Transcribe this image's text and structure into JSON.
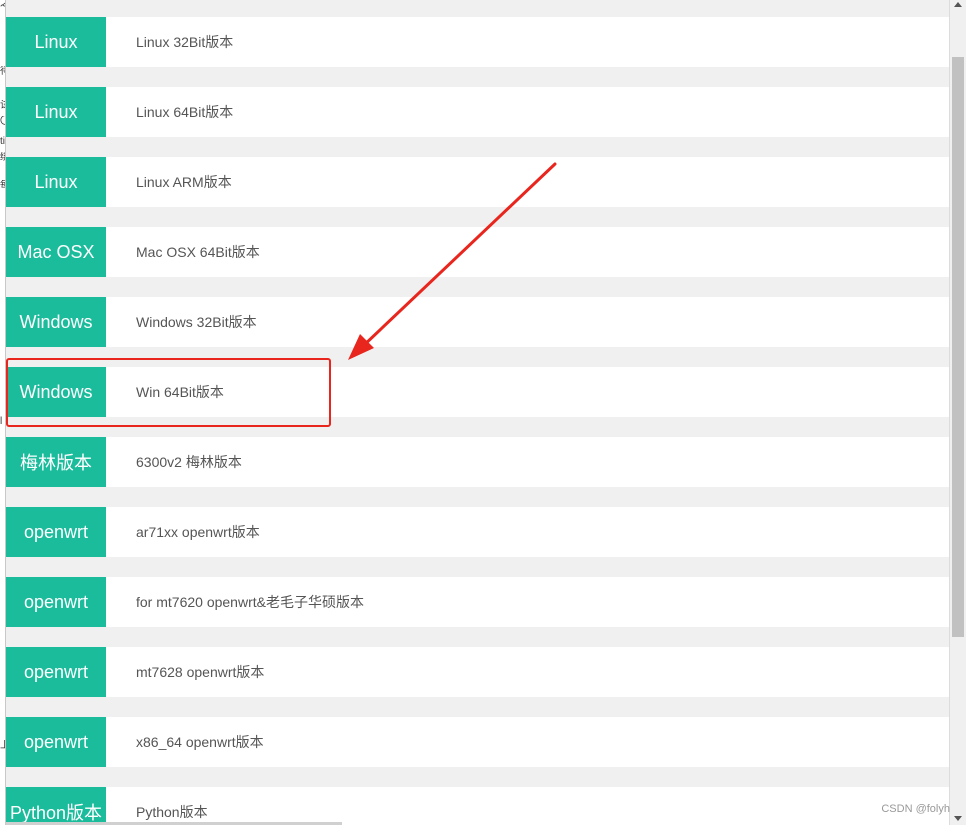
{
  "left_edge_fragments": [
    "之",
    "待",
    "试",
    "〇",
    "ti",
    "绑",
    "每",
    "l",
    "上"
  ],
  "items": [
    {
      "tag": "Linux",
      "desc": "Linux 32Bit版本"
    },
    {
      "tag": "Linux",
      "desc": "Linux 64Bit版本"
    },
    {
      "tag": "Linux",
      "desc": "Linux ARM版本"
    },
    {
      "tag": "Mac OSX",
      "desc": "Mac OSX 64Bit版本"
    },
    {
      "tag": "Windows",
      "desc": "Windows 32Bit版本"
    },
    {
      "tag": "Windows",
      "desc": "Win 64Bit版本"
    },
    {
      "tag": "梅林版本",
      "desc": "6300v2 梅林版本"
    },
    {
      "tag": "openwrt",
      "desc": "ar71xx openwrt版本"
    },
    {
      "tag": "openwrt",
      "desc": "for mt7620 openwrt&老毛子华硕版本"
    },
    {
      "tag": "openwrt",
      "desc": "mt7628 openwrt版本"
    },
    {
      "tag": "openwrt",
      "desc": "x86_64 openwrt版本"
    },
    {
      "tag": "Python版本",
      "desc": "Python版本"
    }
  ],
  "annotation": {
    "color": "#e8261d"
  },
  "watermark": "CSDN @folyh",
  "colors": {
    "tag_bg": "#1abc9c",
    "page_bg": "#f0f0f0",
    "row_bg": "#ffffff"
  }
}
